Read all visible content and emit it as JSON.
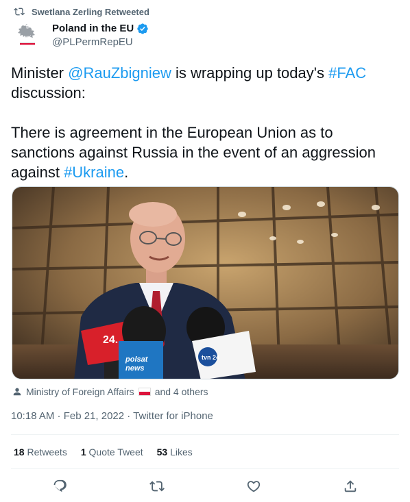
{
  "retweet_banner": {
    "text": "Swetlana Zerling Retweeted",
    "icon": "retweet-icon"
  },
  "author": {
    "name": "Poland in the EU",
    "handle": "@PLPermRepEU",
    "verified": true,
    "avatar_icon": "polish-eagle-emblem"
  },
  "tweet": {
    "p1_prefix": "Minister ",
    "mention": "@RauZbigniew",
    "p1_middle": " is wrapping up today's ",
    "hashtag_fac": "#FAC",
    "p1_suffix": " discussion:",
    "p2_prefix": "There is agreement in the European Union as to sanctions against Russia in the event of an aggression against ",
    "hashtag_ukraine": "#Ukraine",
    "p2_suffix": "."
  },
  "media": {
    "description_icon": "photo",
    "mic_labels": {
      "mic1": "24.",
      "mic2_line1": "polsat",
      "mic2_line2": "news",
      "mic3": "tvn 24"
    }
  },
  "tags": {
    "tagged": "Ministry of Foreign Affairs",
    "others": "and 4 others",
    "flag": "poland-flag-emoji"
  },
  "meta": {
    "text": "10:18 AM · Feb 21, 2022 · Twitter for iPhone"
  },
  "stats": {
    "retweets_count": "18",
    "retweets_label": " Retweets",
    "quotes_count": "1",
    "quotes_label": " Quote Tweet",
    "likes_count": "53",
    "likes_label": " Likes"
  },
  "actions": [
    "reply-icon",
    "retweet-icon",
    "like-icon",
    "share-icon"
  ],
  "colors": {
    "link": "#1d9bf0",
    "secondary_text": "#536471",
    "primary_text": "#0f1419",
    "divider": "#eff3f4"
  }
}
